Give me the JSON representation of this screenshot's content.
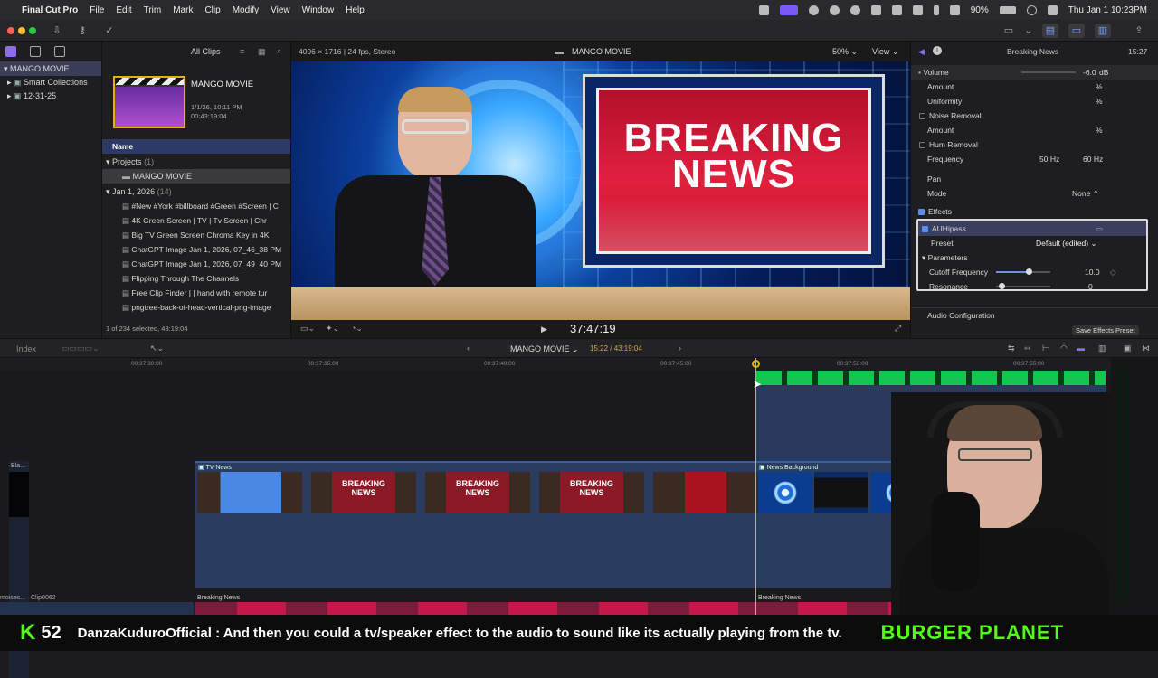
{
  "menubar": {
    "app_name": "Final Cut Pro",
    "menus": [
      "File",
      "Edit",
      "Trim",
      "Mark",
      "Clip",
      "Modify",
      "View",
      "Window",
      "Help"
    ],
    "battery": "90%",
    "clock": "Thu Jan 1  10:23PM"
  },
  "library": {
    "items": [
      {
        "label": "MANGO MOVIE"
      },
      {
        "label": "Smart Collections"
      },
      {
        "label": "12-31-25"
      }
    ]
  },
  "browser": {
    "filter_label": "All Clips",
    "project_card": {
      "title": "MANGO MOVIE",
      "date": "1/1/26, 10:11 PM",
      "duration": "00:43:19:04"
    },
    "column_header": "Name",
    "projects_group": {
      "label": "Projects",
      "count": "(1)"
    },
    "project_item": "MANGO MOVIE",
    "event_group": {
      "label": "Jan 1, 2026",
      "count": "(14)"
    },
    "clips": [
      "#New #York #billboard #Green #Screen | C",
      "4K Green Screen  |  TV  |  Tv Screen  |  Chr",
      "Big TV Green Screen Chroma Key in 4K",
      "ChatGPT Image Jan 1, 2026, 07_46_38 PM",
      "ChatGPT Image Jan 1, 2026, 07_49_40 PM",
      "Flipping Through The Channels",
      "Free Clip Finder  |  | hand with remote tur",
      "pngtree-back-of-head-vertical-png-image"
    ],
    "status": "1 of 234 selected, 43:19:04"
  },
  "viewer": {
    "format": "4096 × 1716 | 24 fps, Stereo",
    "title": "MANGO MOVIE",
    "zoom": "50%",
    "view_label": "View",
    "screen_line1": "BREAKING",
    "screen_line2": "NEWS",
    "timecode": "37:47:19"
  },
  "inspector": {
    "clip_name": "Breaking News",
    "clip_time": "15:27",
    "volume": {
      "label": "Volume",
      "value": "-6.0",
      "unit": "dB"
    },
    "amount1": {
      "label": "Amount",
      "unit": "%"
    },
    "uniformity": {
      "label": "Uniformity",
      "unit": "%"
    },
    "noise_removal": "Noise Removal",
    "amount2": {
      "label": "Amount",
      "unit": "%"
    },
    "hum_removal": "Hum Removal",
    "frequency": {
      "label": "Frequency",
      "v1": "50 Hz",
      "v2": "60 Hz"
    },
    "pan": "Pan",
    "mode": {
      "label": "Mode",
      "value": "None"
    },
    "effects": "Effects",
    "effect_name": "AUHipass",
    "preset": {
      "label": "Preset",
      "value": "Default (edited)"
    },
    "parameters": "Parameters",
    "cutoff": {
      "label": "Cutoff Frequency",
      "value": "10.0",
      "fraction": 0.6
    },
    "resonance": {
      "label": "Resonance",
      "value": "0",
      "fraction": 0.1
    },
    "audio_config": "Audio Configuration",
    "save_preset": "Save Effects Preset"
  },
  "timeline": {
    "index_label": "Index",
    "project": "MANGO MOVIE",
    "position": "15:22 / 43:19:04",
    "ruler_ticks": [
      "00:37:30:00",
      "00:37:35:00",
      "00:37:40:00",
      "00:37:45:00",
      "00:37:50:00",
      "00:37:55:00"
    ],
    "clip_tv_news": "TV News",
    "clip_news_background": "News Background",
    "clip_small": "Bla...",
    "audio_clips": [
      "Breaking News",
      "Breaking News"
    ],
    "lower_labels": [
      "moises...",
      "Clip0062"
    ],
    "thumb_text_1": "BREAKING",
    "thumb_text_2": "NEWS"
  },
  "ticker": {
    "badge": "K",
    "count": "52",
    "message": "DanzaKuduroOfficial : And then you could a tv/speaker effect to the audio to sound like its actually playing from the tv.",
    "brand": "BURGER PLANET"
  }
}
